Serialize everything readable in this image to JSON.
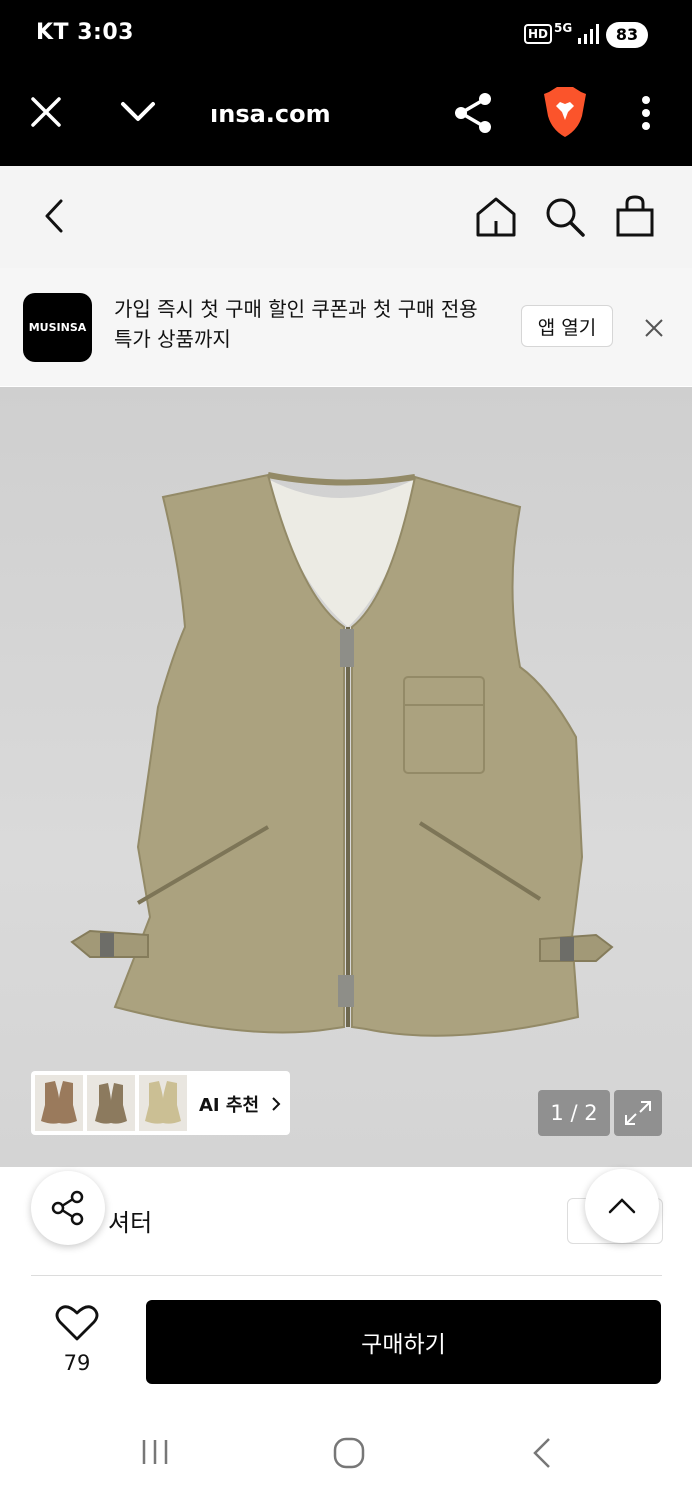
{
  "status_bar": {
    "carrier_time": "KT 3:03",
    "hd_label": "HD",
    "network": "5G",
    "battery": "83"
  },
  "browser": {
    "url": "ınsa.com",
    "close_icon": "close-icon",
    "collapse_icon": "chevron-down-icon",
    "share_icon": "share-icon",
    "brave_icon": "brave-lion-icon",
    "menu_icon": "more-vertical-icon"
  },
  "header": {
    "back_icon": "chevron-left-icon",
    "home_icon": "home-icon",
    "search_icon": "search-icon",
    "cart_icon": "shopping-bag-icon"
  },
  "promo": {
    "logo_text": "MUSINSA",
    "message": "가입 즉시 첫 구매 할인 쿠폰과 첫 구매 전용 특가 상품까지",
    "open_app_label": "앱 열기",
    "close_icon": "close-icon"
  },
  "gallery": {
    "ai_recommend_label": "AI 추천",
    "counter": "1 / 2",
    "expand_icon": "expand-icon",
    "colors": {
      "vest": "#aba27f",
      "lining": "#ecebe4",
      "background": "#d2d2d2"
    }
  },
  "product": {
    "category_label": "셔터"
  },
  "purchase": {
    "like_count": "79",
    "buy_label": "구매하기"
  },
  "colors": {
    "brand_black": "#000000"
  }
}
